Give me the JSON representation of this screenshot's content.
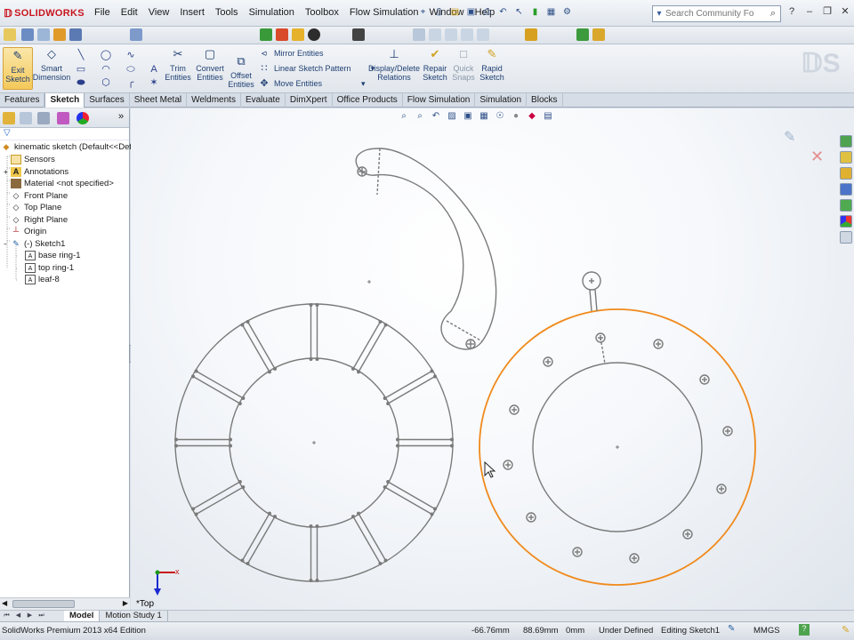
{
  "app": {
    "logo": "SOLIDWORKS",
    "menus": [
      "File",
      "Edit",
      "View",
      "Insert",
      "Tools",
      "Simulation",
      "Toolbox",
      "Flow Simulation",
      "Window",
      "Help"
    ],
    "search_placeholder": "Search Community Forum"
  },
  "command_manager": {
    "exit_sketch": "Exit\nSketch",
    "smart_dimension": "Smart\nDimension",
    "trim_entities": "Trim\nEntities",
    "convert_entities": "Convert\nEntities",
    "offset_entities": "Offset\nEntities",
    "mirror_entities": "Mirror Entities",
    "linear_sketch_pattern": "Linear Sketch Pattern",
    "move_entities": "Move Entities",
    "display_delete_relations": "Display/Delete\nRelations",
    "repair_sketch": "Repair\nSketch",
    "quick_snaps": "Quick\nSnaps",
    "rapid_sketch": "Rapid\nSketch"
  },
  "tabs": [
    "Features",
    "Sketch",
    "Surfaces",
    "Sheet Metal",
    "Weldments",
    "Evaluate",
    "DimXpert",
    "Office Products",
    "Flow Simulation",
    "Simulation",
    "Blocks"
  ],
  "active_tab": "Sketch",
  "feature_tree": {
    "root": "kinematic sketch  (Default<<Def",
    "items": [
      {
        "label": "Sensors",
        "indent": 1
      },
      {
        "label": "Annotations",
        "indent": 1
      },
      {
        "label": "Material <not specified>",
        "indent": 1
      },
      {
        "label": "Front Plane",
        "indent": 1
      },
      {
        "label": "Top Plane",
        "indent": 1
      },
      {
        "label": "Right Plane",
        "indent": 1
      },
      {
        "label": "Origin",
        "indent": 1
      },
      {
        "label": "(-) Sketch1",
        "indent": 1
      },
      {
        "label": "base ring-1",
        "indent": 2
      },
      {
        "label": "top ring-1",
        "indent": 2
      },
      {
        "label": "leaf-8",
        "indent": 2
      }
    ]
  },
  "canvas": {
    "view_label": "*Top",
    "triad_x": "x",
    "triad_y": "y"
  },
  "bottom_tabs": [
    "Model",
    "Motion Study 1"
  ],
  "status": {
    "product": "SolidWorks Premium 2013 x64 Edition",
    "x": "-66.76mm",
    "y": "88.69mm",
    "z": "0mm",
    "definition": "Under Defined",
    "editing": "Editing Sketch1",
    "units": "MMGS"
  },
  "colors": {
    "sketch_line": "#7a7a7a",
    "selected_ring": "#f08a1c",
    "brand_red": "#c8141e"
  }
}
